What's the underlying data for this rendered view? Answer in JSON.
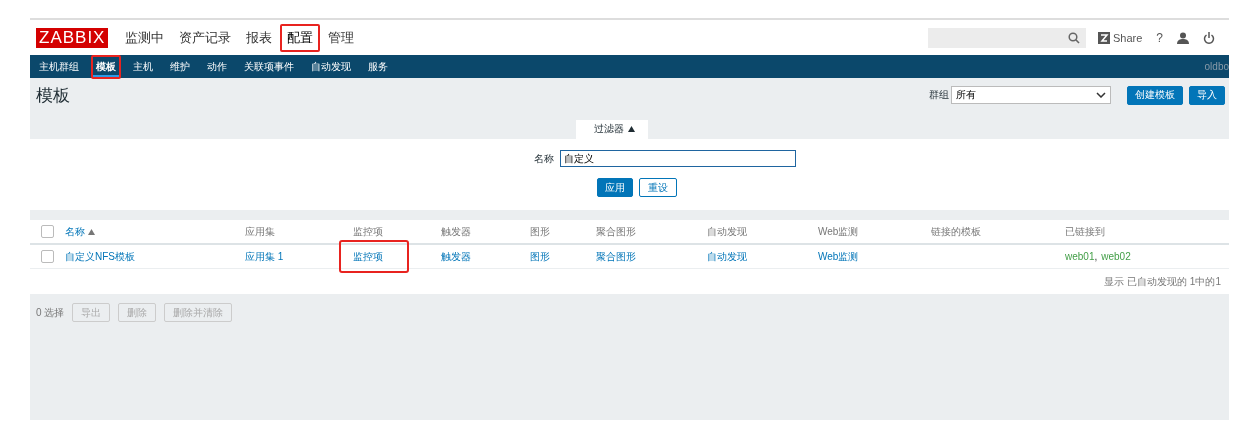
{
  "header": {
    "logo": "ZABBIX",
    "menu": [
      {
        "label": "监测中",
        "selected": false,
        "highlighted": false
      },
      {
        "label": "资产记录",
        "selected": false,
        "highlighted": false
      },
      {
        "label": "报表",
        "selected": false,
        "highlighted": false
      },
      {
        "label": "配置",
        "selected": true,
        "highlighted": true
      },
      {
        "label": "管理",
        "selected": false,
        "highlighted": false
      }
    ],
    "share": "Share",
    "help": "?"
  },
  "subnav": {
    "items": [
      {
        "label": "主机群组",
        "selected": false,
        "highlighted": false
      },
      {
        "label": "模板",
        "selected": true,
        "highlighted": true
      },
      {
        "label": "主机",
        "selected": false,
        "highlighted": false
      },
      {
        "label": "维护",
        "selected": false,
        "highlighted": false
      },
      {
        "label": "动作",
        "selected": false,
        "highlighted": false
      },
      {
        "label": "关联项事件",
        "selected": false,
        "highlighted": false
      },
      {
        "label": "自动发现",
        "selected": false,
        "highlighted": false
      },
      {
        "label": "服务",
        "selected": false,
        "highlighted": false
      }
    ],
    "user": "oldbo"
  },
  "page": {
    "title": "模板",
    "group_label": "群组",
    "group_value": "所有",
    "buttons": [
      "创建模板",
      "导入"
    ]
  },
  "filter": {
    "tab": "过滤器",
    "expanded": true,
    "name_label": "名称",
    "name_value": "自定义",
    "apply": "应用",
    "reset": "重设"
  },
  "table": {
    "columns": [
      {
        "label": "名称",
        "sorted": true
      },
      {
        "label": "应用集",
        "sorted": false
      },
      {
        "label": "监控项",
        "sorted": false
      },
      {
        "label": "触发器",
        "sorted": false
      },
      {
        "label": "图形",
        "sorted": false
      },
      {
        "label": "聚合图形",
        "sorted": false
      },
      {
        "label": "自动发现",
        "sorted": false
      },
      {
        "label": "Web监测",
        "sorted": false
      },
      {
        "label": "链接的模板",
        "sorted": false
      },
      {
        "label": "已链接到",
        "sorted": false
      }
    ],
    "rows": [
      {
        "checked": false,
        "cells": [
          {
            "text": "自定义NFS模板",
            "highlighted": false
          },
          {
            "text": "应用集 1",
            "highlighted": false
          },
          {
            "text": "监控项",
            "highlighted": true
          },
          {
            "text": "触发器",
            "highlighted": false
          },
          {
            "text": "图形",
            "highlighted": false
          },
          {
            "text": "聚合图形",
            "highlighted": false
          },
          {
            "text": "自动发现",
            "highlighted": false
          },
          {
            "text": "Web监测",
            "highlighted": false
          }
        ],
        "linked": [
          "web01",
          "web02"
        ],
        "separator": ","
      }
    ],
    "all_checked": false,
    "footer": "显示 已自动发现的 1中的1"
  },
  "actions": {
    "count": "0 选择",
    "buttons": [
      {
        "label": "导出",
        "disabled": true
      },
      {
        "label": "删除",
        "disabled": true
      },
      {
        "label": "删除并清除",
        "disabled": true
      }
    ]
  }
}
